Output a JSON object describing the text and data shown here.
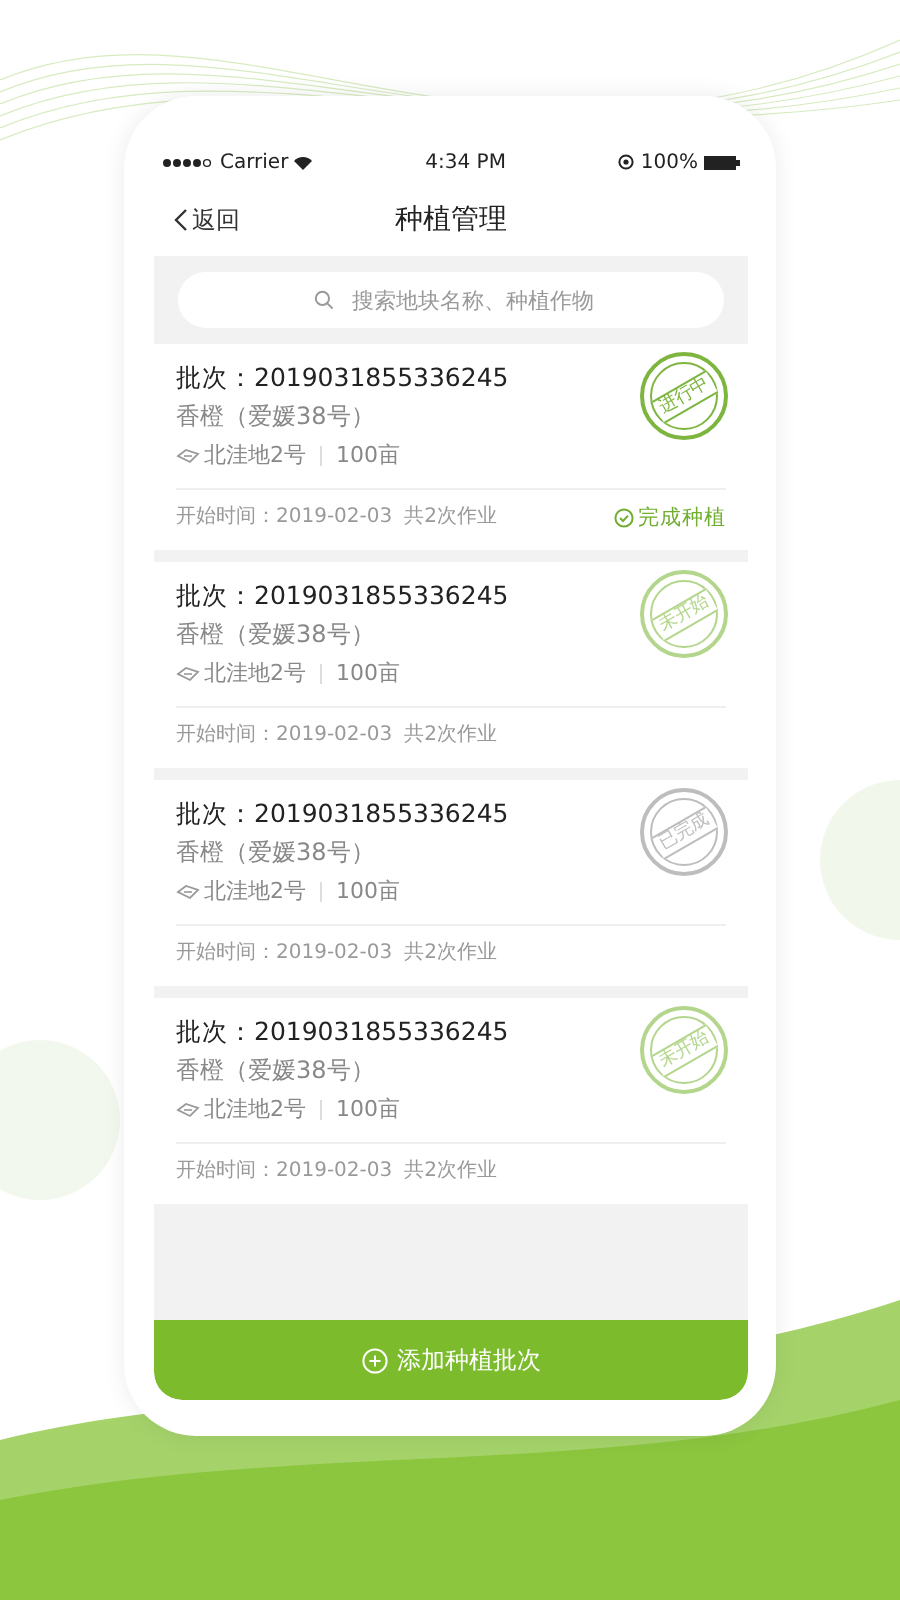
{
  "status_bar": {
    "carrier": "Carrier",
    "time": "4:34 PM",
    "battery": "100%"
  },
  "nav": {
    "back": "返回",
    "title": "种植管理"
  },
  "search": {
    "placeholder": "搜索地块名称、种植作物"
  },
  "batches": [
    {
      "batch": "批次：2019031855336245",
      "crop": "香橙（爱媛38号）",
      "plot": "北洼地2号",
      "area": "100亩",
      "start": "开始时间：2019-02-03",
      "jobs": "共2次作业",
      "stamp": "进行中",
      "color": "#7db53f",
      "action": "完成种植"
    },
    {
      "batch": "批次：2019031855336245",
      "crop": "香橙（爱媛38号）",
      "plot": "北洼地2号",
      "area": "100亩",
      "start": "开始时间：2019-02-03",
      "jobs": "共2次作业",
      "stamp": "未开始",
      "color": "#b3d68c"
    },
    {
      "batch": "批次：2019031855336245",
      "crop": "香橙（爱媛38号）",
      "plot": "北洼地2号",
      "area": "100亩",
      "start": "开始时间：2019-02-03",
      "jobs": "共2次作业",
      "stamp": "已完成",
      "color": "#bdbdbd"
    },
    {
      "batch": "批次：2019031855336245",
      "crop": "香橙（爱媛38号）",
      "plot": "北洼地2号",
      "area": "100亩",
      "start": "开始时间：2019-02-03",
      "jobs": "共2次作业",
      "stamp": "未开始",
      "color": "#b3d68c"
    }
  ],
  "add_button": "添加种植批次"
}
